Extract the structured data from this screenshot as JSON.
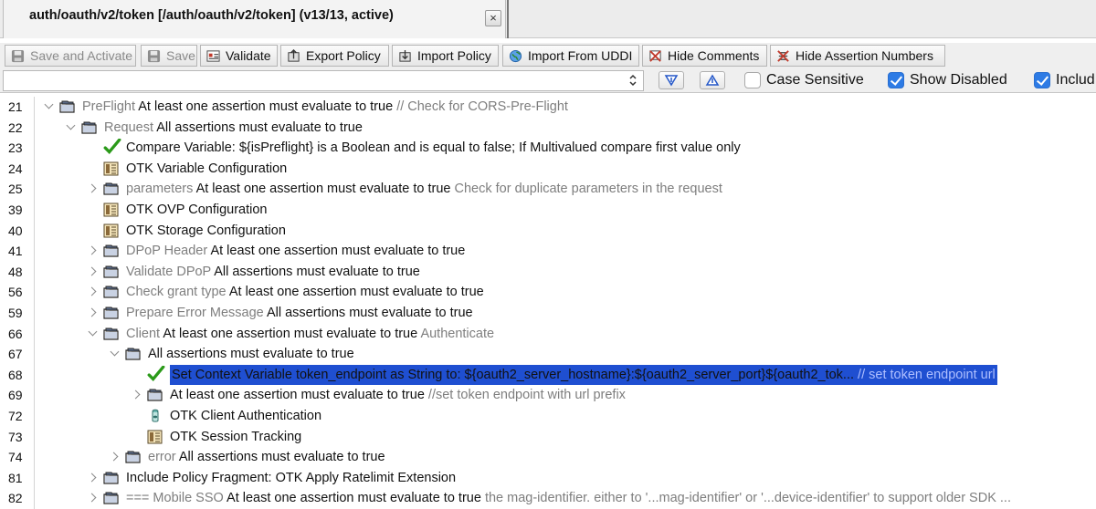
{
  "tab": {
    "title": "auth/oauth/v2/token [/auth/oauth/v2/token] (v13/13, active)",
    "close_glyph": "×"
  },
  "toolbar": {
    "save_activate": "Save and Activate",
    "save": "Save",
    "validate": "Validate",
    "export": "Export Policy",
    "import": "Import Policy",
    "import_uddi": "Import From UDDI",
    "hide_comments": "Hide Comments",
    "hide_numbers": "Hide Assertion Numbers"
  },
  "search": {
    "value": "",
    "options": {
      "case_sensitive": {
        "label": "Case Sensitive",
        "checked": false
      },
      "show_disabled": {
        "label": "Show Disabled",
        "checked": true
      },
      "include": {
        "label": "Includ",
        "checked": true
      }
    }
  },
  "colors": {
    "selection": "#1f4fd1",
    "accent": "#2d7be5",
    "check_green": "#2b9a1a"
  },
  "rows": [
    {
      "line": "21",
      "level": 0,
      "expander": "open",
      "icon": "folder-icon",
      "name": "PreFlight",
      "desc": "At least one assertion must evaluate to true",
      "comment": "// Check for CORS-Pre-Flight"
    },
    {
      "line": "22",
      "level": 1,
      "expander": "open",
      "icon": "folder-icon",
      "name": "Request",
      "desc": "All assertions must evaluate to true",
      "comment": ""
    },
    {
      "line": "23",
      "level": 2,
      "expander": "",
      "icon": "check-icon",
      "name": "",
      "desc": "Compare Variable: ${isPreflight} is a Boolean and is equal to false; If Multivalued compare first value only",
      "comment": ""
    },
    {
      "line": "24",
      "level": 2,
      "expander": "",
      "icon": "config-icon",
      "name": "",
      "desc": "OTK Variable Configuration",
      "comment": ""
    },
    {
      "line": "25",
      "level": 2,
      "expander": "closed",
      "icon": "folder-icon",
      "name": "parameters",
      "desc": "At least one assertion must evaluate to true",
      "comment": "Check for duplicate parameters in the request"
    },
    {
      "line": "39",
      "level": 2,
      "expander": "",
      "icon": "config-icon",
      "name": "",
      "desc": "OTK OVP Configuration",
      "comment": ""
    },
    {
      "line": "40",
      "level": 2,
      "expander": "",
      "icon": "config-icon",
      "name": "",
      "desc": "OTK Storage Configuration",
      "comment": ""
    },
    {
      "line": "41",
      "level": 2,
      "expander": "closed",
      "icon": "folder-icon",
      "name": "DPoP Header",
      "desc": "At least one assertion must evaluate to true",
      "comment": ""
    },
    {
      "line": "48",
      "level": 2,
      "expander": "closed",
      "icon": "folder-icon",
      "name": "Validate DPoP",
      "desc": "All assertions must evaluate to true",
      "comment": ""
    },
    {
      "line": "56",
      "level": 2,
      "expander": "closed",
      "icon": "folder-icon",
      "name": "Check grant type",
      "desc": "At least one assertion must evaluate to true",
      "comment": ""
    },
    {
      "line": "59",
      "level": 2,
      "expander": "closed",
      "icon": "folder-icon",
      "name": "Prepare Error Message",
      "desc": "All assertions must evaluate to true",
      "comment": ""
    },
    {
      "line": "66",
      "level": 2,
      "expander": "open",
      "icon": "folder-icon",
      "name": "Client",
      "desc": "At least one assertion must evaluate to true",
      "comment": "Authenticate"
    },
    {
      "line": "67",
      "level": 3,
      "expander": "open",
      "icon": "folder-icon",
      "name": "",
      "desc": "All assertions must evaluate to true",
      "comment": ""
    },
    {
      "line": "68",
      "level": 4,
      "expander": "",
      "icon": "check-icon",
      "name": "",
      "desc": "Set Context Variable token_endpoint as String to: ${oauth2_server_hostname}:${oauth2_server_port}${oauth2_tok...",
      "comment": "// set token endpoint url",
      "selected": true
    },
    {
      "line": "69",
      "level": 4,
      "expander": "closed",
      "icon": "folder-icon",
      "name": "",
      "desc": "At least one assertion must evaluate to true",
      "comment": "//set token endpoint with url prefix"
    },
    {
      "line": "72",
      "level": 4,
      "expander": "",
      "icon": "jar-icon",
      "name": "",
      "desc": "OTK Client Authentication",
      "comment": ""
    },
    {
      "line": "73",
      "level": 4,
      "expander": "",
      "icon": "config-icon",
      "name": "",
      "desc": "OTK Session Tracking",
      "comment": ""
    },
    {
      "line": "74",
      "level": 3,
      "expander": "closed",
      "icon": "folder-icon",
      "name": "error",
      "desc": "All assertions must evaluate to true",
      "comment": ""
    },
    {
      "line": "81",
      "level": 2,
      "expander": "closed",
      "icon": "folder-icon",
      "name": "",
      "desc": "Include Policy Fragment: OTK Apply Ratelimit Extension",
      "comment": ""
    },
    {
      "line": "82",
      "level": 2,
      "expander": "closed",
      "icon": "folder-icon",
      "name": "=== Mobile SSO",
      "desc": "At least one assertion must evaluate to true",
      "comment": "the mag-identifier. either to '...mag-identifier' or '...device-identifier' to support older SDK ..."
    }
  ]
}
